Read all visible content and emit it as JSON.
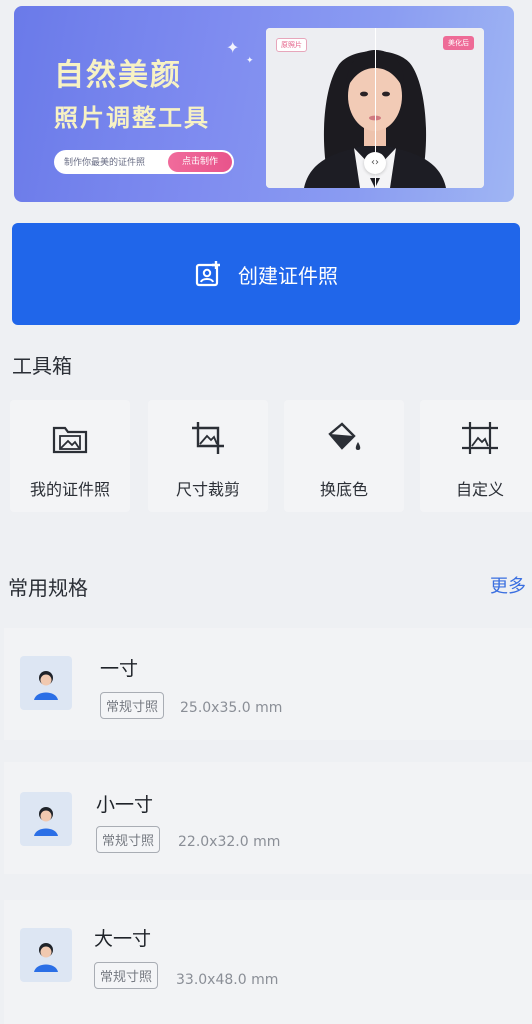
{
  "banner": {
    "title_line1": "自然美颜",
    "title_line2": "照片调整工具",
    "pill_text": "制作你最美的证件照",
    "pill_button": "点击制作",
    "photo_tag_left": "原照片",
    "photo_tag_right": "美化后",
    "compare_handle": "‹›"
  },
  "create_button": {
    "label": "创建证件照"
  },
  "toolbox": {
    "title": "工具箱",
    "items": [
      {
        "label": "我的证件照",
        "icon": "folder-photo-icon"
      },
      {
        "label": "尺寸裁剪",
        "icon": "crop-icon"
      },
      {
        "label": "换底色",
        "icon": "paint-bucket-icon"
      },
      {
        "label": "自定义",
        "icon": "custom-frame-icon"
      }
    ]
  },
  "specs": {
    "title": "常用规格",
    "more": "更多",
    "items": [
      {
        "name": "一寸",
        "badge": "常规寸照",
        "size": "25.0x35.0 mm"
      },
      {
        "name": "小一寸",
        "badge": "常规寸照",
        "size": "22.0x32.0 mm"
      },
      {
        "name": "大一寸",
        "badge": "常规寸照",
        "size": "33.0x48.0 mm"
      }
    ]
  },
  "colors": {
    "primary": "#2066ea",
    "accent_pink": "#e8548b",
    "link": "#3a6fe0"
  }
}
